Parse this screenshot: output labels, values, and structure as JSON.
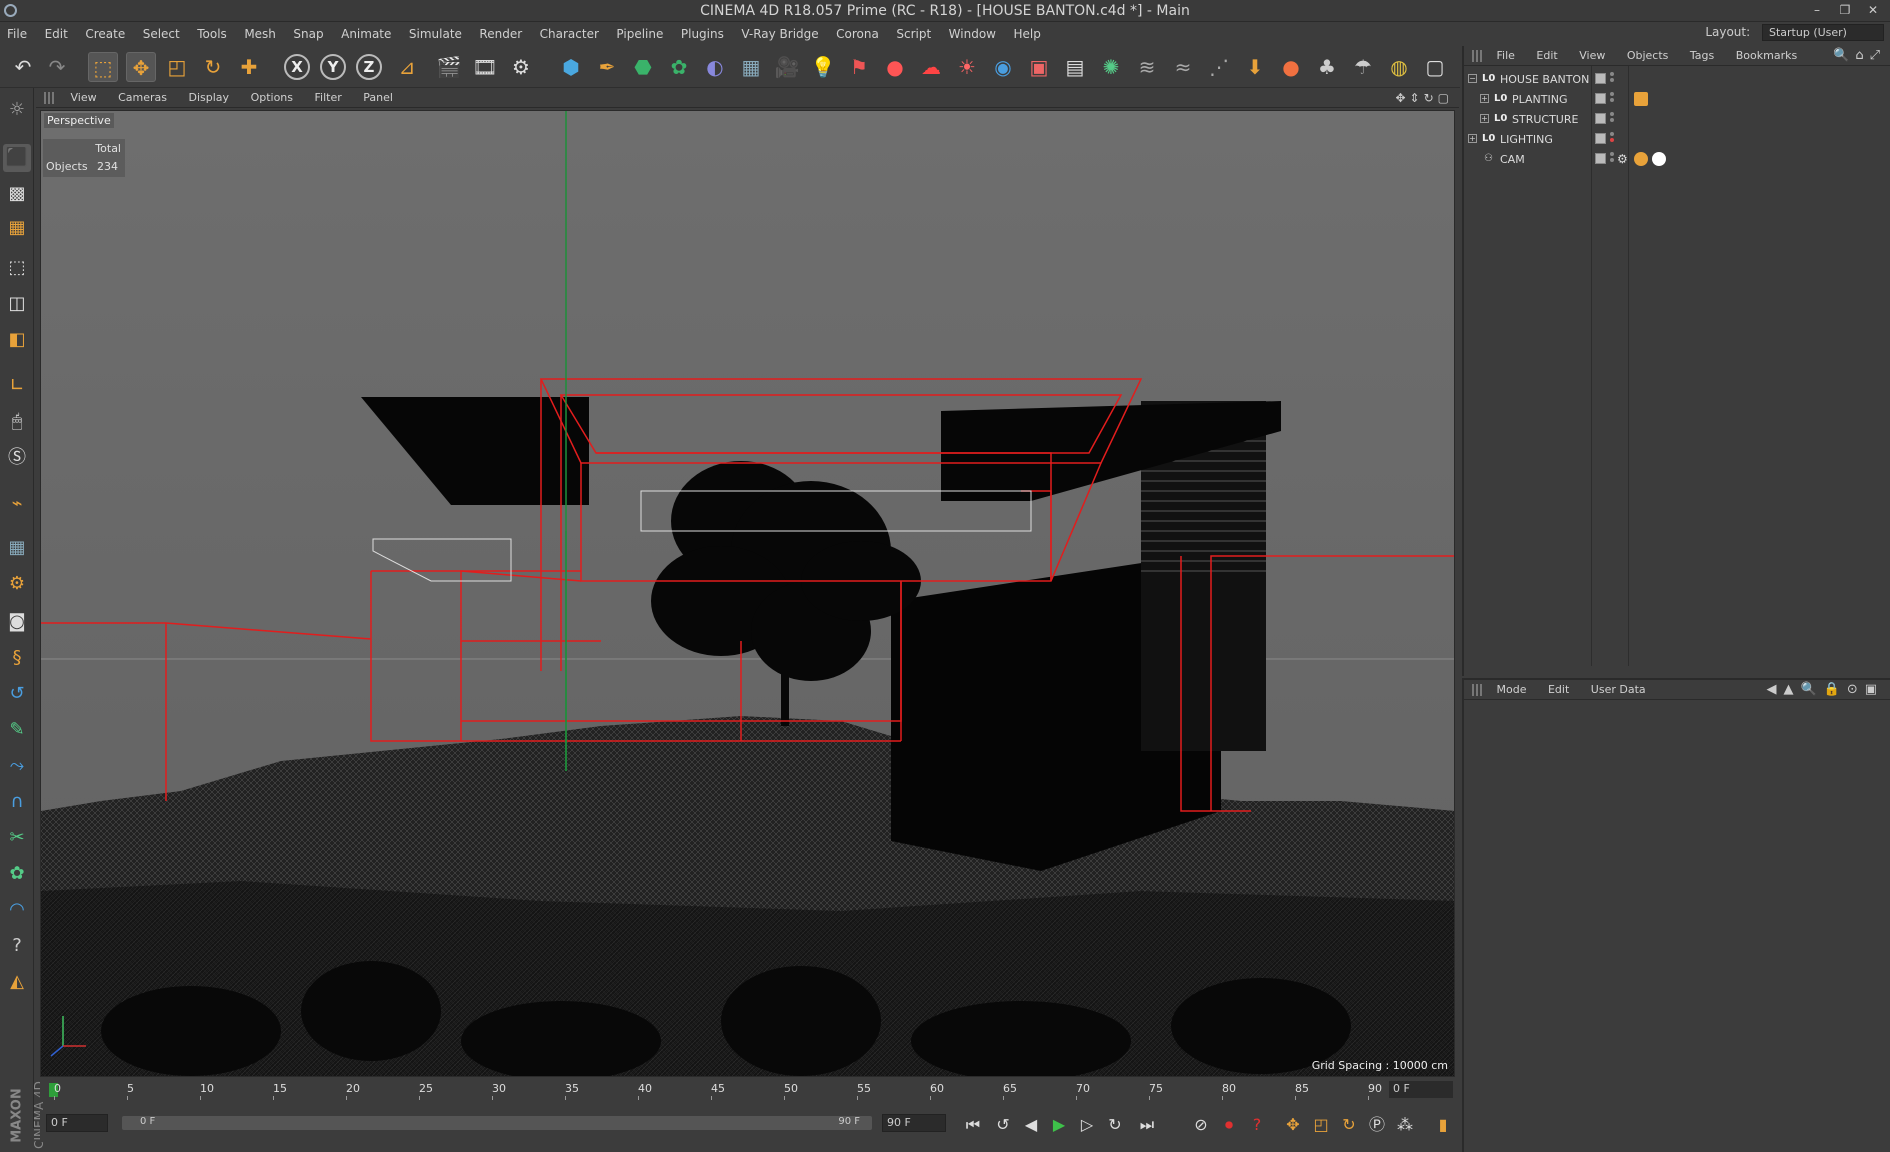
{
  "window": {
    "title": "CINEMA 4D R18.057 Prime (RC - R18) - [HOUSE BANTON.c4d *] - Main",
    "minimize": "–",
    "restore": "❐",
    "close": "✕"
  },
  "menubar": {
    "items": [
      "File",
      "Edit",
      "Create",
      "Select",
      "Tools",
      "Mesh",
      "Snap",
      "Animate",
      "Simulate",
      "Render",
      "Character",
      "Pipeline",
      "Plugins",
      "V-Ray Bridge",
      "Corona",
      "Script",
      "Window",
      "Help"
    ],
    "layout_label": "Layout:",
    "layout_value": "Startup (User)"
  },
  "toolbar": {
    "axis_x": "X",
    "axis_y": "Y",
    "axis_z": "Z",
    "icons": [
      "undo-icon",
      "redo-icon",
      "live-selection-icon",
      "move-icon",
      "scale-icon",
      "rotate-icon",
      "recent-tool-icon",
      "x-axis-icon",
      "y-axis-icon",
      "z-axis-icon",
      "coordinate-system-icon",
      "render-view-icon",
      "render-picture-viewer-icon",
      "edit-render-settings-icon",
      "cube-icon",
      "pen-icon",
      "subdivision-icon",
      "array-icon",
      "deformer-icon",
      "floor-icon",
      "camera-icon",
      "light-icon",
      "render-farm-icon",
      "bulb-icon",
      "cloud-icon",
      "sun-icon",
      "sphere-icon",
      "frame-icon",
      "picture-icon",
      "hair-icon",
      "sketch-icon"
    ]
  },
  "viewport": {
    "menu": [
      "View",
      "Cameras",
      "Display",
      "Options",
      "Filter",
      "Panel"
    ],
    "label": "Perspective",
    "hud_header": "Total",
    "hud_key": "Objects",
    "hud_value": "234",
    "grid_spacing": "Grid Spacing : 10000 cm"
  },
  "timeline": {
    "ticks": [
      "0",
      "5",
      "10",
      "15",
      "20",
      "25",
      "30",
      "35",
      "40",
      "45",
      "50",
      "55",
      "60",
      "65",
      "70",
      "75",
      "80",
      "85",
      "90"
    ],
    "current_frame": "0 F"
  },
  "transport": {
    "start_field": "0 F",
    "slider_left": "0 F",
    "slider_right": "90 F",
    "end_field": "90 F"
  },
  "object_manager": {
    "menu": [
      "File",
      "Edit",
      "View",
      "Objects",
      "Tags",
      "Bookmarks"
    ],
    "objects": [
      {
        "name": "HOUSE BANTON",
        "level": 0,
        "expand": "−"
      },
      {
        "name": "PLANTING",
        "level": 1,
        "expand": "+"
      },
      {
        "name": "STRUCTURE",
        "level": 1,
        "expand": "+"
      },
      {
        "name": "LIGHTING",
        "level": 0,
        "expand": "+"
      },
      {
        "name": "CAM",
        "level": 1,
        "expand": ""
      }
    ]
  },
  "attribute_manager": {
    "menu": [
      "Mode",
      "Edit",
      "User Data"
    ]
  },
  "branding": {
    "maxon": "MAXON",
    "cinema": "CINEMA 4D"
  },
  "colors": {
    "accent": "#e8a23a",
    "wire_red": "#e21d1d",
    "viewport_bg": "#666666",
    "panel_bg": "#3c3c3c",
    "timeline_cursor": "#2e9e3a"
  }
}
